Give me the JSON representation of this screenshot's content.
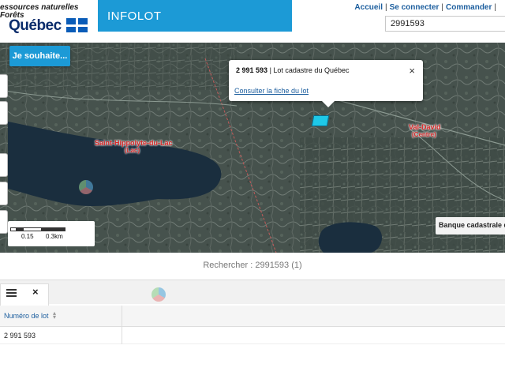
{
  "header": {
    "ministry_line1": "essources naturelles",
    "ministry_line2": "Forêts",
    "quebec": "Québec",
    "app_title": "INFOLOT",
    "links": [
      "Accueil",
      "Se connecter",
      "Commander"
    ],
    "link_separator": "|",
    "search_value": "2991593"
  },
  "map": {
    "souhaite_button": "Je souhaite...",
    "popup": {
      "lot_number": "2 991 593",
      "lot_description": "| Lot cadastre du Québec",
      "close": "×",
      "link": "Consulter la fiche du lot"
    },
    "scale": {
      "label1": "0.15",
      "label2": "0.3km"
    },
    "layer_button": "Banque cadastrale d",
    "labels": {
      "lake_label": "Saint-Hippolyte-du-Lac",
      "lake_label_sub": "(Lac)",
      "place_label": "Val-David",
      "place_label_sub": "(Centre)"
    }
  },
  "search_result": {
    "text": "Rechercher : 2991593 (1)"
  },
  "results_table": {
    "tab_close": "×",
    "columns": [
      "Numéro de lot"
    ],
    "rows": [
      [
        "2 991 593"
      ]
    ]
  },
  "colors": {
    "brand_blue": "#1c9ad6",
    "link_blue": "#1c5e9e",
    "lot_highlight": "#1ec8e8"
  }
}
